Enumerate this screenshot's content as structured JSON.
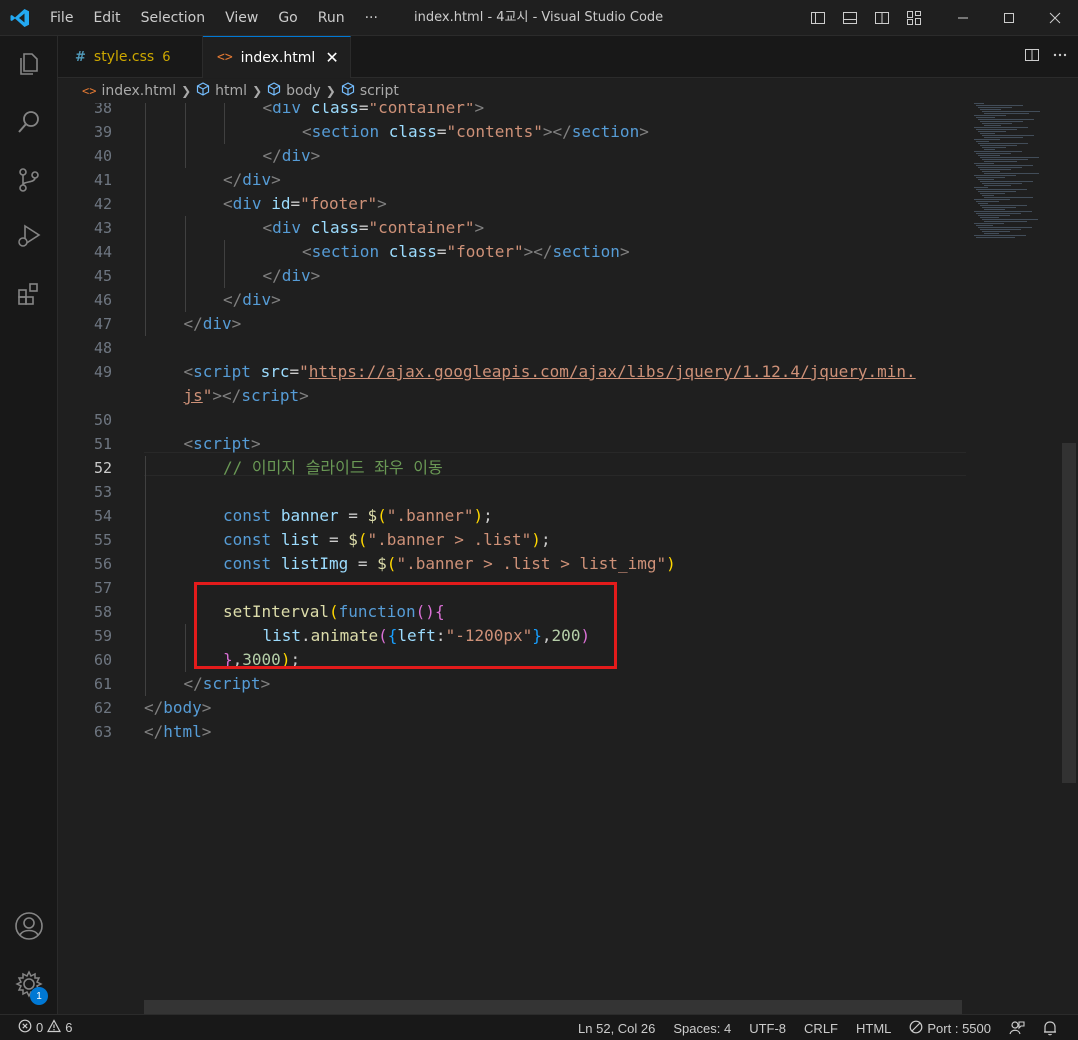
{
  "titlebar": {
    "menu": [
      "File",
      "Edit",
      "Selection",
      "View",
      "Go",
      "Run",
      "···"
    ],
    "title": "index.html - 4교시 - Visual Studio Code"
  },
  "tabs": [
    {
      "icon": "#",
      "name": "style.css",
      "count": "6",
      "active": false
    },
    {
      "icon": "<>",
      "name": "index.html",
      "close": "✕",
      "active": true
    }
  ],
  "breadcrumb": {
    "items": [
      "index.html",
      "html",
      "body",
      "script"
    ]
  },
  "editor": {
    "current_line": "52",
    "lines": [
      {
        "n": "38",
        "indent": 3,
        "tokens": [
          [
            "br",
            "<"
          ],
          [
            "tag",
            "div"
          ],
          [
            "plain",
            " "
          ],
          [
            "att",
            "class"
          ],
          [
            "plain",
            "="
          ],
          [
            "str",
            "\"container\""
          ],
          [
            "br",
            ">"
          ]
        ]
      },
      {
        "n": "39",
        "indent": 4,
        "tokens": [
          [
            "br",
            "<"
          ],
          [
            "tag",
            "section"
          ],
          [
            "plain",
            " "
          ],
          [
            "att",
            "class"
          ],
          [
            "plain",
            "="
          ],
          [
            "str",
            "\"contents\""
          ],
          [
            "br",
            "></"
          ],
          [
            "tag",
            "section"
          ],
          [
            "br",
            ">"
          ]
        ]
      },
      {
        "n": "40",
        "indent": 3,
        "tokens": [
          [
            "br",
            "</"
          ],
          [
            "tag",
            "div"
          ],
          [
            "br",
            ">"
          ]
        ]
      },
      {
        "n": "41",
        "indent": 2,
        "tokens": [
          [
            "br",
            "</"
          ],
          [
            "tag",
            "div"
          ],
          [
            "br",
            ">"
          ]
        ]
      },
      {
        "n": "42",
        "indent": 2,
        "tokens": [
          [
            "br",
            "<"
          ],
          [
            "tag",
            "div"
          ],
          [
            "plain",
            " "
          ],
          [
            "att",
            "id"
          ],
          [
            "plain",
            "="
          ],
          [
            "str",
            "\"footer\""
          ],
          [
            "br",
            ">"
          ]
        ]
      },
      {
        "n": "43",
        "indent": 3,
        "tokens": [
          [
            "br",
            "<"
          ],
          [
            "tag",
            "div"
          ],
          [
            "plain",
            " "
          ],
          [
            "att",
            "class"
          ],
          [
            "plain",
            "="
          ],
          [
            "str",
            "\"container\""
          ],
          [
            "br",
            ">"
          ]
        ]
      },
      {
        "n": "44",
        "indent": 4,
        "tokens": [
          [
            "br",
            "<"
          ],
          [
            "tag",
            "section"
          ],
          [
            "plain",
            " "
          ],
          [
            "att",
            "class"
          ],
          [
            "plain",
            "="
          ],
          [
            "str",
            "\"footer\""
          ],
          [
            "br",
            "></"
          ],
          [
            "tag",
            "section"
          ],
          [
            "br",
            ">"
          ]
        ]
      },
      {
        "n": "45",
        "indent": 3,
        "tokens": [
          [
            "br",
            "</"
          ],
          [
            "tag",
            "div"
          ],
          [
            "br",
            ">"
          ]
        ]
      },
      {
        "n": "46",
        "indent": 2,
        "tokens": [
          [
            "br",
            "</"
          ],
          [
            "tag",
            "div"
          ],
          [
            "br",
            ">"
          ]
        ]
      },
      {
        "n": "47",
        "indent": 1,
        "tokens": [
          [
            "br",
            "</"
          ],
          [
            "tag",
            "div"
          ],
          [
            "br",
            ">"
          ]
        ]
      },
      {
        "n": "48",
        "indent": 0,
        "tokens": []
      },
      {
        "n": "49",
        "indent": 1,
        "tokens": [
          [
            "br",
            "<"
          ],
          [
            "tag",
            "script"
          ],
          [
            "plain",
            " "
          ],
          [
            "att",
            "src"
          ],
          [
            "plain",
            "="
          ],
          [
            "str",
            "\""
          ],
          [
            "url",
            "https://ajax.googleapis.com/ajax/libs/jquery/1.12.4/jquery.min."
          ]
        ]
      },
      {
        "n": "",
        "indent": 1,
        "tokens": [
          [
            "url",
            "js"
          ],
          [
            "str",
            "\""
          ],
          [
            "br",
            "></"
          ],
          [
            "tag",
            "script"
          ],
          [
            "br",
            ">"
          ]
        ]
      },
      {
        "n": "50",
        "indent": 0,
        "tokens": []
      },
      {
        "n": "51",
        "indent": 1,
        "tokens": [
          [
            "br",
            "<"
          ],
          [
            "tag",
            "script"
          ],
          [
            "br",
            ">"
          ]
        ]
      },
      {
        "n": "52",
        "indent": 2,
        "tokens": [
          [
            "com",
            "// 이미지 슬라이드 좌우 이동"
          ]
        ]
      },
      {
        "n": "53",
        "indent": 0,
        "tokens": []
      },
      {
        "n": "54",
        "indent": 2,
        "tokens": [
          [
            "kw",
            "const"
          ],
          [
            "plain",
            " "
          ],
          [
            "var",
            "banner"
          ],
          [
            "plain",
            " = "
          ],
          [
            "fn",
            "$"
          ],
          [
            "p1",
            "("
          ],
          [
            "str",
            "\".banner\""
          ],
          [
            "p1",
            ")"
          ],
          [
            "plain",
            ";"
          ]
        ]
      },
      {
        "n": "55",
        "indent": 2,
        "tokens": [
          [
            "kw",
            "const"
          ],
          [
            "plain",
            " "
          ],
          [
            "var",
            "list"
          ],
          [
            "plain",
            " = "
          ],
          [
            "fn",
            "$"
          ],
          [
            "p1",
            "("
          ],
          [
            "str",
            "\".banner > .list\""
          ],
          [
            "p1",
            ")"
          ],
          [
            "plain",
            ";"
          ]
        ]
      },
      {
        "n": "56",
        "indent": 2,
        "tokens": [
          [
            "kw",
            "const"
          ],
          [
            "plain",
            " "
          ],
          [
            "var",
            "listImg"
          ],
          [
            "plain",
            " = "
          ],
          [
            "fn",
            "$"
          ],
          [
            "p1",
            "("
          ],
          [
            "str",
            "\".banner > .list > list_img\""
          ],
          [
            "p1",
            ")"
          ]
        ]
      },
      {
        "n": "57",
        "indent": 0,
        "tokens": []
      },
      {
        "n": "58",
        "indent": 2,
        "tokens": [
          [
            "fn",
            "setInterval"
          ],
          [
            "p1",
            "("
          ],
          [
            "kw",
            "function"
          ],
          [
            "p2",
            "(){"
          ]
        ]
      },
      {
        "n": "59",
        "indent": 3,
        "tokens": [
          [
            "var",
            "list"
          ],
          [
            "plain",
            "."
          ],
          [
            "fn",
            "animate"
          ],
          [
            "p2",
            "("
          ],
          [
            "p3",
            "{"
          ],
          [
            "var",
            "left"
          ],
          [
            "plain",
            ":"
          ],
          [
            "str",
            "\"-1200px\""
          ],
          [
            "p3",
            "}"
          ],
          [
            "plain",
            ","
          ],
          [
            "num",
            "200"
          ],
          [
            "p2",
            ")"
          ]
        ]
      },
      {
        "n": "60",
        "indent": 2,
        "tokens": [
          [
            "p2",
            "}"
          ],
          [
            "plain",
            ","
          ],
          [
            "num",
            "3000"
          ],
          [
            "p1",
            ")"
          ],
          [
            "plain",
            ";"
          ]
        ]
      },
      {
        "n": "61",
        "indent": 1,
        "tokens": [
          [
            "br",
            "</"
          ],
          [
            "tag",
            "script"
          ],
          [
            "br",
            ">"
          ]
        ]
      },
      {
        "n": "62",
        "indent": 0,
        "tokens": [
          [
            "br",
            "</"
          ],
          [
            "tag",
            "body"
          ],
          [
            "br",
            ">"
          ]
        ]
      },
      {
        "n": "63",
        "indent": 0,
        "tokens": [
          [
            "br",
            "</"
          ],
          [
            "tag",
            "html"
          ],
          [
            "br",
            ">"
          ]
        ]
      }
    ]
  },
  "statusbar": {
    "errors": "0",
    "warnings": "6",
    "position": "Ln 52, Col 26",
    "spaces": "Spaces: 4",
    "encoding": "UTF-8",
    "eol": "CRLF",
    "language": "HTML",
    "port": "Port : 5500"
  },
  "activity": {
    "settings_badge": "1"
  },
  "colors": {
    "accent": "#0078d4",
    "highlight_box": "#e31b1b"
  }
}
